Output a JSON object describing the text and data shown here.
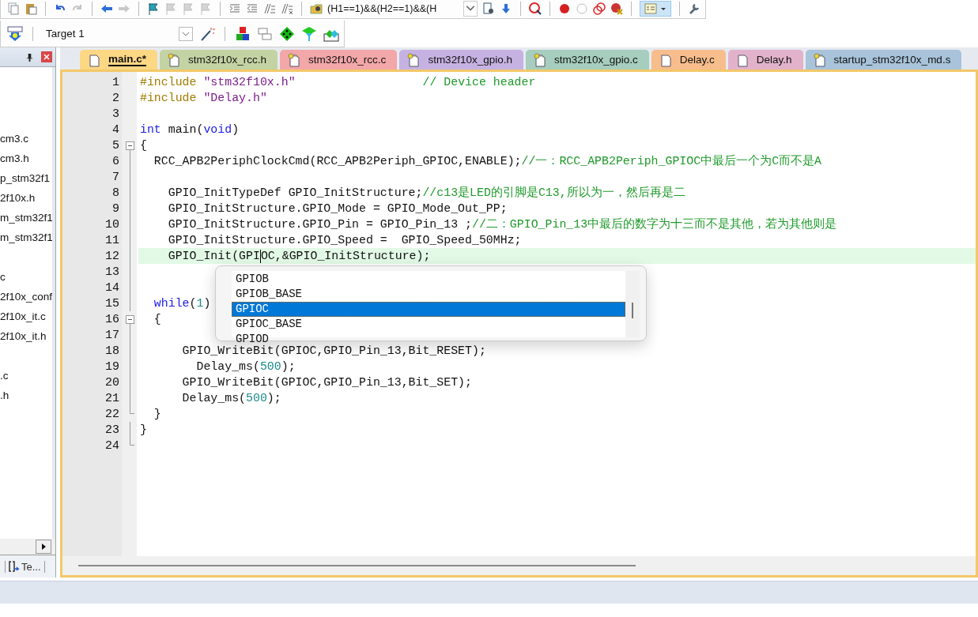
{
  "toolbar": {
    "buttons": [
      {
        "disabled": false
      },
      {
        "disabled": false
      },
      {
        "disabled": false
      },
      {
        "disabled": true
      },
      {
        "disabled": false
      },
      {
        "disabled": true
      },
      {
        "disabled": false
      },
      {
        "disabled": true
      },
      {
        "disabled": true
      },
      {
        "disabled": true
      },
      {
        "disabled": false
      },
      {
        "disabled": false
      },
      {
        "disabled": false
      },
      {
        "disabled": false
      },
      {
        "disabled": false
      }
    ],
    "expression": "(H1==1)&&(H2==1)&&(H",
    "window_button": {
      "selected": true
    }
  },
  "build_toolbar": {
    "target": "Target 1"
  },
  "project_panel": {
    "groups": [
      [
        "cm3.c",
        "cm3.h",
        "p_stm32f1",
        "2f10x.h",
        "m_stm32f1",
        "m_stm32f1"
      ],
      [
        "c",
        "2f10x_conf",
        "2f10x_it.c",
        "2f10x_it.h"
      ],
      [
        ".c",
        ".h"
      ]
    ],
    "bottom_tab": "Te..."
  },
  "tabs": [
    {
      "label": "main.c*",
      "selected": true,
      "kind": "file",
      "color": "#fcd784"
    },
    {
      "label": "stm32f10x_rcc.h",
      "selected": false,
      "kind": "keyed",
      "color": "#c4d3a3"
    },
    {
      "label": "stm32f10x_rcc.c",
      "selected": false,
      "kind": "keyed",
      "color": "#f2a7a9"
    },
    {
      "label": "stm32f10x_gpio.h",
      "selected": false,
      "kind": "keyed",
      "color": "#c6b2e2"
    },
    {
      "label": "stm32f10x_gpio.c",
      "selected": false,
      "kind": "keyed",
      "color": "#a6cdbd"
    },
    {
      "label": "Delay.c",
      "selected": false,
      "kind": "file",
      "color": "#f8bd8c"
    },
    {
      "label": "Delay.h",
      "selected": false,
      "kind": "file",
      "color": "#e2b2cb"
    },
    {
      "label": "startup_stm32f10x_md.s",
      "selected": false,
      "kind": "keyed",
      "color": "#a8c3da"
    }
  ],
  "code": {
    "lines": [
      {
        "no": "1",
        "tokens": [
          {
            "t": "#include ",
            "kind": "pre"
          },
          {
            "t": "\"stm32f10x.h\"",
            "kind": "str"
          },
          {
            "t": "                  // Device header",
            "kind": "com"
          }
        ]
      },
      {
        "no": "2",
        "tokens": [
          {
            "t": "#include ",
            "kind": "pre"
          },
          {
            "t": "\"Delay.h\"",
            "kind": "str"
          }
        ]
      },
      {
        "no": "3"
      },
      {
        "no": "4",
        "tokens": [
          {
            "t": "int",
            "kind": "kw"
          },
          {
            "t": " main(",
            "kind": "plain"
          },
          {
            "t": "void",
            "kind": "kw"
          },
          {
            "t": ")",
            "kind": "plain"
          }
        ]
      },
      {
        "no": "5",
        "fold_start": true,
        "tokens": [
          {
            "t": "{",
            "kind": "plain"
          }
        ]
      },
      {
        "no": "6",
        "tokens": [
          {
            "t": "  RCC_APB2PeriphClockCmd(RCC_APB2Periph_GPIOC,ENABLE);",
            "kind": "plain"
          },
          {
            "t": "//一：RCC_APB2Periph_GPIOC中最后一个为C而不是A",
            "kind": "com"
          }
        ]
      },
      {
        "no": "7"
      },
      {
        "no": "8",
        "tokens": [
          {
            "t": "    GPIO_InitTypeDef GPIO_InitStructure;",
            "kind": "plain"
          },
          {
            "t": "//c13是LED的引脚是C13,所以为一，然后再是二",
            "kind": "com"
          }
        ]
      },
      {
        "no": "9",
        "tokens": [
          {
            "t": "    GPIO_InitStructure.GPIO_Mode = GPIO_Mode_Out_PP;",
            "kind": "plain"
          }
        ]
      },
      {
        "no": "10",
        "tokens": [
          {
            "t": "    GPIO_InitStructure.GPIO_Pin = GPIO_Pin_13 ;",
            "kind": "plain"
          },
          {
            "t": "//二：GPIO_Pin_13中最后的数字为十三而不是其他，若为其他则是",
            "kind": "com"
          }
        ]
      },
      {
        "no": "11",
        "tokens": [
          {
            "t": "    GPIO_InitStructure.GPIO_Speed =  GPIO_Speed_50MHz;",
            "kind": "plain"
          }
        ]
      },
      {
        "no": "12",
        "current": true,
        "tokens": [
          {
            "t": "    GPIO_Init(GPI",
            "kind": "plain"
          },
          {
            "t": "OC,&GPIO_InitStructure);",
            "kind": "plain",
            "caret_before": true
          }
        ]
      },
      {
        "no": "13"
      },
      {
        "no": "14"
      },
      {
        "no": "15",
        "tokens": [
          {
            "t": "  while",
            "kind": "kw"
          },
          {
            "t": "(",
            "kind": "plain"
          },
          {
            "t": "1",
            "kind": "num"
          },
          {
            "t": ")",
            "kind": "plain"
          }
        ]
      },
      {
        "no": "16",
        "fold_start": true,
        "tokens": [
          {
            "t": "  {",
            "kind": "plain"
          }
        ]
      },
      {
        "no": "17"
      },
      {
        "no": "18",
        "tokens": [
          {
            "t": "      GPIO_WriteBit(GPIOC,GPIO_Pin_13,Bit_RESET);",
            "kind": "plain"
          }
        ]
      },
      {
        "no": "19",
        "tokens": [
          {
            "t": "        Delay_ms(",
            "kind": "plain"
          },
          {
            "t": "500",
            "kind": "num"
          },
          {
            "t": ");",
            "kind": "plain"
          }
        ]
      },
      {
        "no": "20",
        "tokens": [
          {
            "t": "      GPIO_WriteBit(GPIOC,GPIO_Pin_13,Bit_SET);",
            "kind": "plain"
          }
        ]
      },
      {
        "no": "21",
        "tokens": [
          {
            "t": "      Delay_ms(",
            "kind": "plain"
          },
          {
            "t": "500",
            "kind": "num"
          },
          {
            "t": ");",
            "kind": "plain"
          }
        ]
      },
      {
        "no": "22",
        "fold_end": true,
        "tokens": [
          {
            "t": "  }",
            "kind": "plain"
          }
        ]
      },
      {
        "no": "23",
        "tokens": [
          {
            "t": "}",
            "kind": "plain"
          }
        ]
      },
      {
        "no": "24",
        "fold_end": true
      }
    ]
  },
  "completion": {
    "items": [
      {
        "label": "GPIOB",
        "selected": false
      },
      {
        "label": "GPIOB_BASE",
        "selected": false
      },
      {
        "label": "GPIOC",
        "selected": true
      },
      {
        "label": "GPIOC_BASE",
        "selected": false
      },
      {
        "label": "GPIOD",
        "selected": false
      }
    ]
  }
}
